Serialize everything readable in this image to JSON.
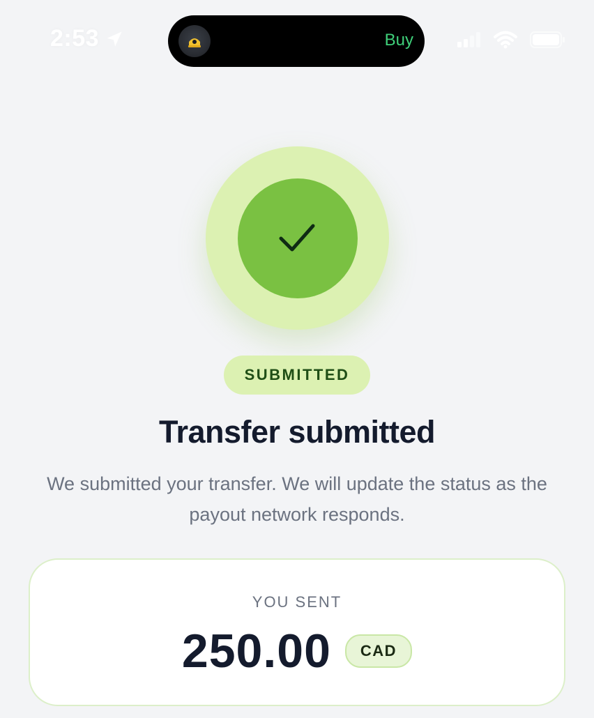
{
  "status_bar": {
    "time": "2:53"
  },
  "live_activity": {
    "action_label": "Buy"
  },
  "status": {
    "pill_label": "SUBMITTED"
  },
  "title": "Transfer submitted",
  "subtitle": "We submitted your transfer. We will update the status as the payout network responds.",
  "amount_card": {
    "label": "YOU SENT",
    "amount": "250.00",
    "currency": "CAD"
  },
  "icons": {
    "success": "checkmark-icon",
    "location": "location-arrow-icon",
    "signal": "cellular-signal-icon",
    "wifi": "wifi-icon",
    "battery": "battery-icon"
  },
  "colors": {
    "accent_green": "#7ac142",
    "halo_green": "#dcf1b2",
    "live_activity_text": "#3fd07a"
  }
}
